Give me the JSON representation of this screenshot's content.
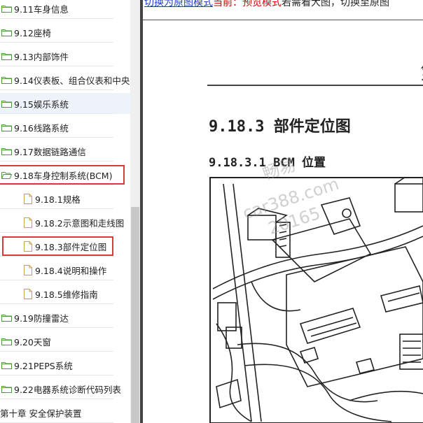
{
  "tree": {
    "items": [
      {
        "label": "9.11车身信息",
        "level": 1,
        "icon": "folder-icon"
      },
      {
        "label": "9.12座椅",
        "level": 1,
        "icon": "folder-icon"
      },
      {
        "label": "9.13内部饰件",
        "level": 1,
        "icon": "folder-icon"
      },
      {
        "label": "9.14仪表板、组合仪表和中央",
        "level": 1,
        "icon": "folder-icon"
      },
      {
        "label": "9.15娱乐系统",
        "level": 1,
        "icon": "folder-icon",
        "highlighted": true
      },
      {
        "label": "9.16线路系统",
        "level": 1,
        "icon": "folder-icon"
      },
      {
        "label": "9.17数据链路通信",
        "level": 1,
        "icon": "folder-icon"
      },
      {
        "label": "9.18车身控制系统(BCM)",
        "level": 1,
        "icon": "folder-open-icon",
        "boxed": true
      },
      {
        "label": "9.18.1规格",
        "level": 2,
        "icon": "page-icon"
      },
      {
        "label": "9.18.2示意图和走线图",
        "level": 2,
        "icon": "page-icon"
      },
      {
        "label": "9.18.3部件定位图",
        "level": 2,
        "icon": "page-icon",
        "boxed": true
      },
      {
        "label": "9.18.4说明和操作",
        "level": 2,
        "icon": "page-icon"
      },
      {
        "label": "9.18.5维修指南",
        "level": 2,
        "icon": "page-icon"
      },
      {
        "label": "9.19防撞雷达",
        "level": 1,
        "icon": "folder-icon"
      },
      {
        "label": "9.20天窗",
        "level": 1,
        "icon": "folder-icon"
      },
      {
        "label": "9.21PEPS系统",
        "level": 1,
        "icon": "folder-icon"
      },
      {
        "label": "9.22电器系统诊断代码列表",
        "level": 1,
        "icon": "folder-icon"
      },
      {
        "label": "第十章 安全保护装置",
        "level": 0,
        "icon": ""
      }
    ]
  },
  "doc": {
    "notice": {
      "link": "切换为原图模式",
      "warn": "当前：预览模式",
      "rest": "若需看大图，切换至原图"
    },
    "chapter_digit": "第",
    "section_title": "9.18.3 部件定位图",
    "subsection_title": "9.18.3.1 BCM 位置",
    "watermark": [
      "畅易",
      "car388.com",
      "20165"
    ]
  },
  "colors": {
    "link": "#1a3cc9",
    "warn": "#d20000",
    "box": "#d83b3b",
    "folder": "#4a9a3a"
  }
}
